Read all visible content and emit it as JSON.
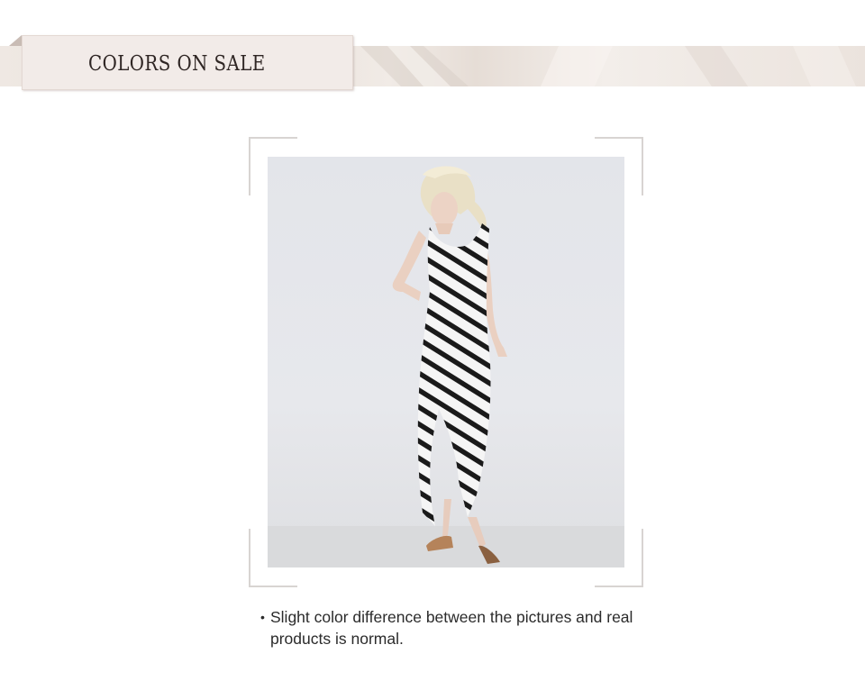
{
  "header": {
    "title": "COLORS ON SALE"
  },
  "product": {
    "image_icon": "model-striped-dress-photo"
  },
  "note": {
    "bullet": "•",
    "text": "Slight color difference between the pictures and real products is normal."
  }
}
